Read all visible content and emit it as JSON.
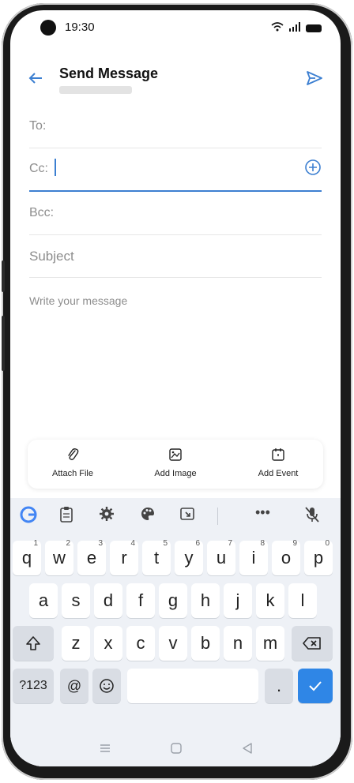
{
  "status_bar": {
    "time": "19:30"
  },
  "header": {
    "title": "Send Message"
  },
  "fields": {
    "to_label": "To:",
    "cc_label": "Cc:",
    "bcc_label": "Bcc:",
    "subject_placeholder": "Subject",
    "message_placeholder": "Write your message"
  },
  "attachments": {
    "attach_file": "Attach File",
    "add_image": "Add Image",
    "add_event": "Add Event"
  },
  "keyboard": {
    "row1": [
      "q",
      "w",
      "e",
      "r",
      "t",
      "y",
      "u",
      "i",
      "o",
      "p"
    ],
    "row1_hints": [
      "1",
      "2",
      "3",
      "4",
      "5",
      "6",
      "7",
      "8",
      "9",
      "0"
    ],
    "row2": [
      "a",
      "s",
      "d",
      "f",
      "g",
      "h",
      "j",
      "k",
      "l"
    ],
    "row3": [
      "z",
      "x",
      "c",
      "v",
      "b",
      "n",
      "m"
    ],
    "symbols_key": "?123",
    "at_key": "@",
    "period_key": "."
  },
  "colors": {
    "accent": "#3c7fd1",
    "enter_key": "#2f86e6"
  }
}
